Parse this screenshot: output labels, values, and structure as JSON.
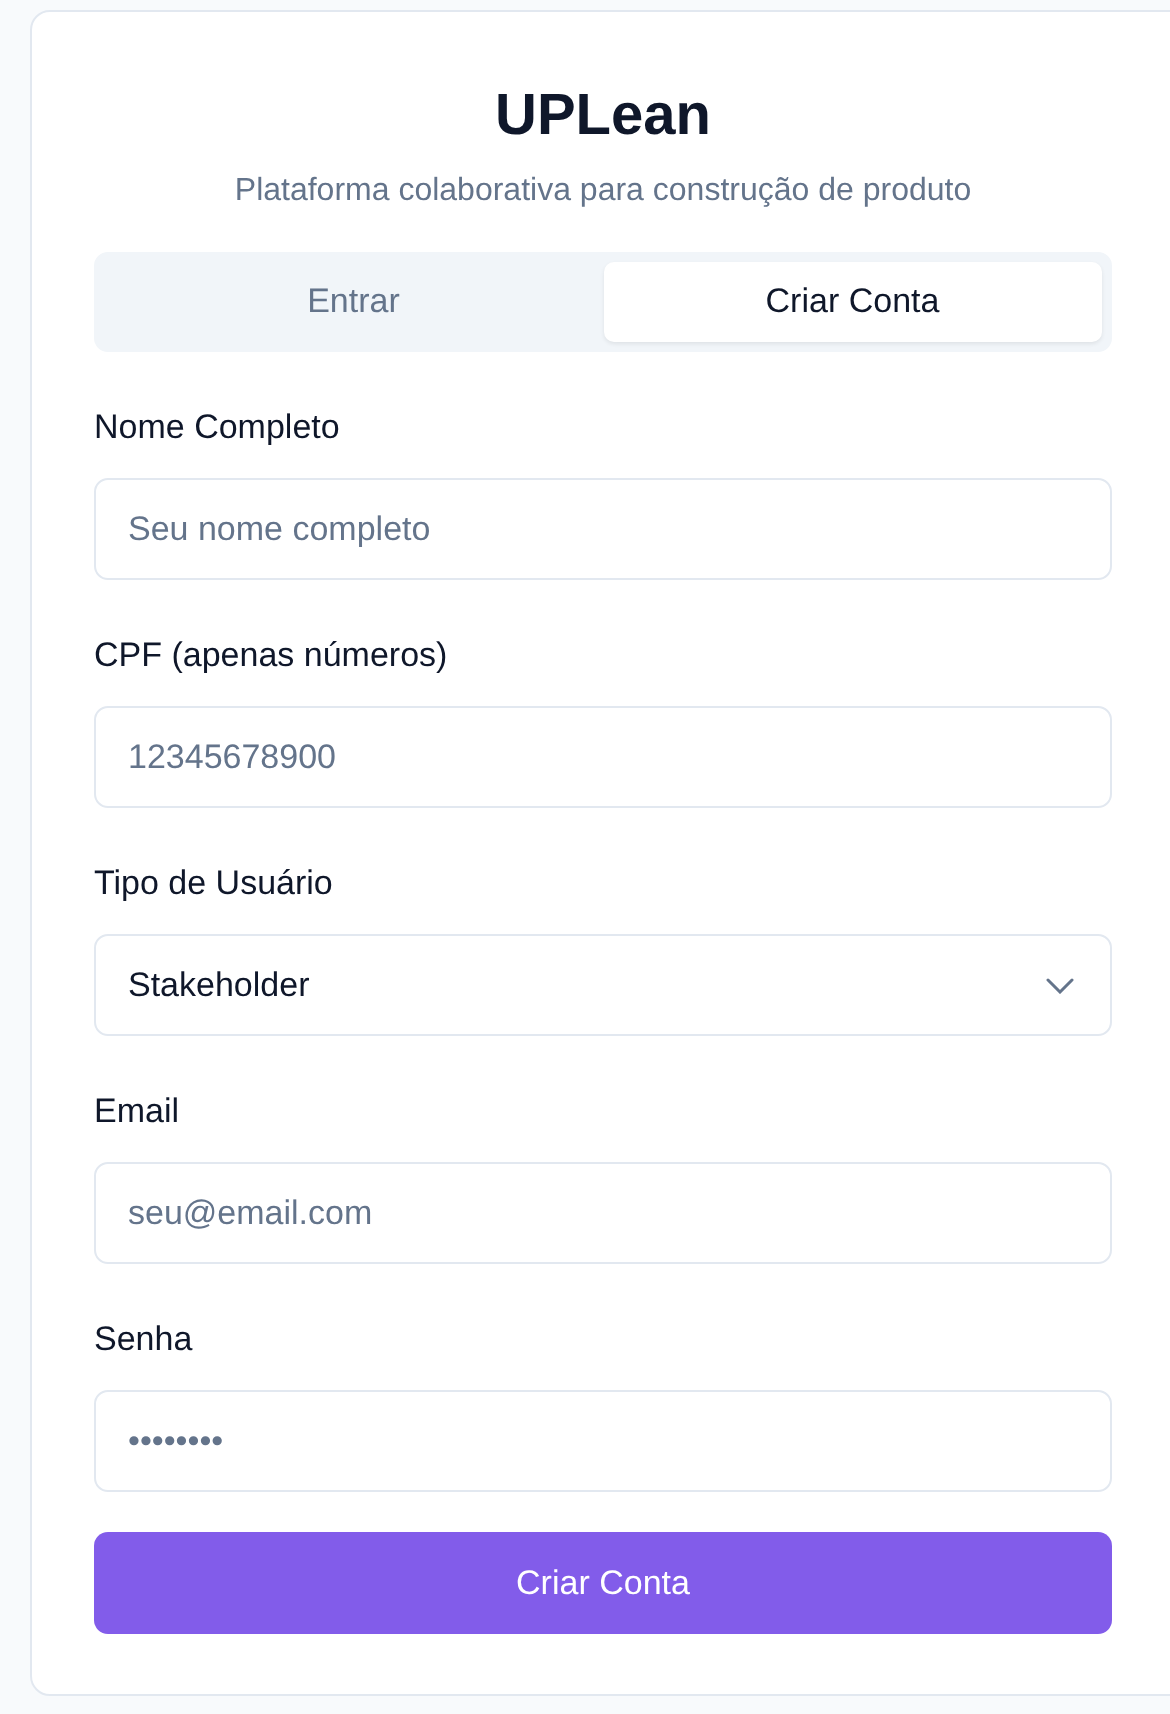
{
  "title": "UPLean",
  "subtitle": "Plataforma colaborativa para construção de produto",
  "tabs": [
    {
      "label": "Entrar",
      "selected": false
    },
    {
      "label": "Criar Conta",
      "selected": true
    }
  ],
  "fields": [
    {
      "kind": "text",
      "label": "Nome Completo",
      "placeholder": "Seu nome completo"
    },
    {
      "kind": "text",
      "label": "CPF (apenas números)",
      "placeholder": "12345678900"
    },
    {
      "kind": "select",
      "label": "Tipo de Usuário",
      "value": "Stakeholder"
    },
    {
      "kind": "text",
      "label": "Email",
      "placeholder": "seu@email.com"
    },
    {
      "kind": "password",
      "label": "Senha",
      "placeholder": "••••••••"
    }
  ],
  "submit": "Criar Conta"
}
